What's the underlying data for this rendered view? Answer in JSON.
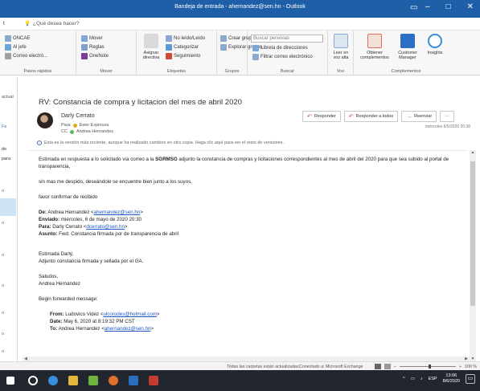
{
  "window": {
    "title": "Bandeja de entrada - ahernandez@sen.hn - Outlook",
    "tell_me": "¿Qué desea hacer?",
    "left_tab": "t"
  },
  "ribbon": {
    "search_people_placeholder": "Buscar personas",
    "groups": {
      "pasos": {
        "label": "Pasos rápidos",
        "items": [
          "ONCAE",
          "Al jefe",
          "Correo electró..."
        ]
      },
      "mover": {
        "label": "Mover",
        "items": [
          "Mover",
          "Reglas",
          "OneNote"
        ]
      },
      "etiquetas": {
        "label": "Etiquetas",
        "items": [
          "Asignar directiva",
          "No leído/Leído",
          "Categorizar",
          "Seguimiento"
        ]
      },
      "grupos": {
        "label": "Grupos",
        "items": [
          "Crear grupo",
          "Explorar grupos"
        ]
      },
      "buscar": {
        "label": "Buscar",
        "items": [
          "Libreta de direcciones",
          "Filtrar correo electrónico"
        ]
      },
      "voz": {
        "label": "Voz",
        "items": [
          "Leer en voz alta"
        ]
      },
      "complementos": {
        "label": "Complementos",
        "items": [
          "Obtener complementos",
          "Customer Manager",
          "Insights"
        ]
      }
    }
  },
  "left_strip": {
    "items": [
      "actual",
      "Fe",
      "do",
      "para",
      "o",
      "o",
      "o",
      "o",
      "o",
      "o",
      "o"
    ]
  },
  "message": {
    "subject": "RV: Constancia de compra y licitacion del mes de abril 2020",
    "from_name": "Darly Cerrato",
    "to_label": "Para",
    "to_name": "Ewer Espinoza",
    "cc_label": "CC",
    "cc_name": "Andrea Hernandez",
    "notice": "Esta es la versión más reciente, aunque ha realizado cambios en otra copia. Haga clic aquí para ver el resto de versiones.",
    "timestamp": "miércoles 6/5/2020 20:38",
    "actions": {
      "reply": "Responder",
      "reply_all": "Responder a todos",
      "forward": "Reenviar",
      "more": "···"
    },
    "body": {
      "p1_start": "Estimada  en respuesta a lo solicitado vía correo  a la ",
      "p1_bold": "SGRMSG",
      "p1_end": " adjunto la constancia  de compras y licitaciones correspondientes al mes de abril del 2020 para que sea subido al portal de transparencia,",
      "p2": "sin mas me despido, deseándole se encuentre bien junto a los suyos,",
      "p3": "favor confirmar de recibido",
      "fw_de_label": "De:",
      "fw_de": "Andrea Hernandez <",
      "fw_de_email": "ahernandez@sen.hn",
      "fw_enviado_label": "Enviado:",
      "fw_enviado": "miércoles, 6 de mayo de 2020 20:30",
      "fw_para_label": "Para:",
      "fw_para": "Darly Cerrato <",
      "fw_para_email": "dcerrato@sen.hn",
      "fw_asunto_label": "Asunto:",
      "fw_asunto": "Fwd: Constancia firmada por de transparencia de abril",
      "p4": "Estimada Darly,",
      "p5": "Adjunto constancia firmada y sellada por el GA.",
      "p6": "Saludos,",
      "p7": "Andrea Hernandez",
      "p8": "Begin forwarded message:",
      "orig_from_label": "From:",
      "orig_from": "Ludovico Videz <",
      "orig_from_email": "ulcorodes@hotmail.com",
      "orig_date_label": "Date:",
      "orig_date": "May 6, 2020 at 8:19:32 PM CST",
      "orig_to_label": "To:",
      "orig_to": "Andrea Hernandez <",
      "orig_to_email": "ahernandez@sen.hn"
    }
  },
  "statusbar": {
    "folders_status": "Todas las carpetas están actualizadas.",
    "connection": "Conectado a: Microsoft Exchange",
    "zoom": "100 %"
  },
  "taskbar": {
    "lang": "ESP",
    "time": "13:06",
    "date": "8/6/2020"
  },
  "colors": {
    "titlebar": "#1f5fa8",
    "link": "#1e58c2",
    "taskbar": "#22272f"
  }
}
